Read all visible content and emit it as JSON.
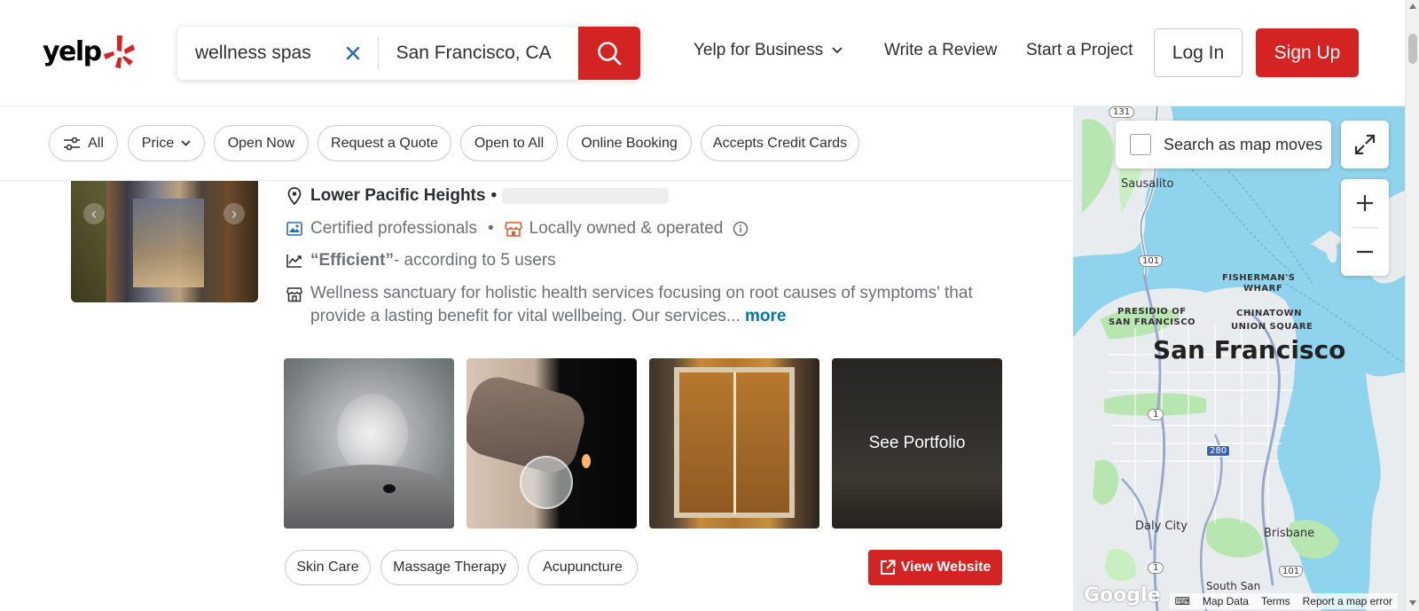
{
  "header": {
    "logo": "yelp",
    "search_find_value": "wellness spas",
    "search_near_value": "San Francisco, CA",
    "nav": {
      "business": "Yelp for Business",
      "review": "Write a Review",
      "project": "Start a Project"
    },
    "login": "Log In",
    "signup": "Sign Up"
  },
  "filters": [
    {
      "label": "All"
    },
    {
      "label": "Price"
    },
    {
      "label": "Open Now"
    },
    {
      "label": "Request a Quote"
    },
    {
      "label": "Open to All"
    },
    {
      "label": "Online Booking"
    },
    {
      "label": "Accepts Credit Cards"
    }
  ],
  "listing": {
    "neighborhood": "Lower Pacific Heights",
    "neighborhood_sep": "•",
    "certified": "Certified professionals",
    "dot": "•",
    "locally_owned": "Locally owned & operated",
    "highlight_quote": "“Efficient”",
    "highlight_suffix": " - according to 5 users",
    "description": "Wellness sanctuary for holistic health services focusing on root causes of symptoms' that provide a lasting benefit for vital wellbeing. Our services...",
    "more": "more",
    "see_portfolio": "See Portfolio",
    "tags": [
      "Skin Care",
      "Massage Therapy",
      "Acupuncture"
    ],
    "view_website": "View Website"
  },
  "map": {
    "search_as_moves": "Search as map moves",
    "labels": {
      "sausalito": "Sausalito",
      "fishermans_wharf_1": "FISHERMAN'S",
      "fishermans_wharf_2": "WHARF",
      "presidio_1": "PRESIDIO OF",
      "presidio_2": "SAN FRANCISCO",
      "chinatown": "CHINATOWN",
      "union_square": "UNION SQUARE",
      "city": "San Francisco",
      "daly_city": "Daly City",
      "brisbane": "Brisbane",
      "south_san": "South San"
    },
    "shields": {
      "r131": "131",
      "r101a": "101",
      "r1a": "1",
      "r280": "280",
      "r1b": "1",
      "r101b": "101"
    },
    "google": "Google",
    "footer": {
      "map_data": "Map Data",
      "terms": "Terms",
      "report": "Report a map error"
    }
  },
  "colors": {
    "brand_red": "#d32323",
    "link_teal": "#027a97",
    "water": "#8fd3ec",
    "land": "#e9ecef",
    "park": "#b8e6b0"
  }
}
